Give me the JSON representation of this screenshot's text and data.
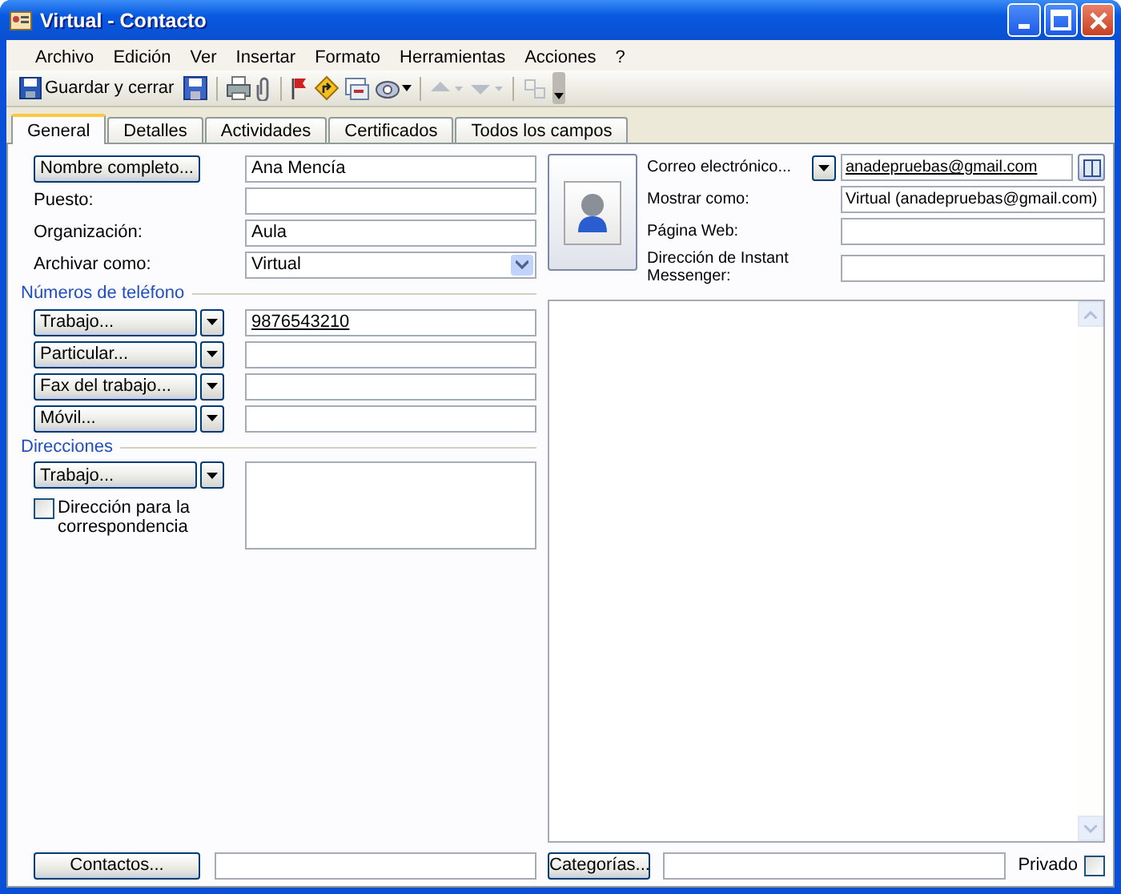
{
  "window": {
    "title": "Virtual - Contacto"
  },
  "menu": [
    "Archivo",
    "Edición",
    "Ver",
    "Insertar",
    "Formato",
    "Herramientas",
    "Acciones",
    "?"
  ],
  "toolbar": {
    "save_label": "Guardar y cerrar"
  },
  "tabs": [
    {
      "label": "General",
      "selected": true
    },
    {
      "label": "Detalles",
      "selected": false
    },
    {
      "label": "Actividades",
      "selected": false
    },
    {
      "label": "Certificados",
      "selected": false
    },
    {
      "label": "Todos los campos",
      "selected": false
    }
  ],
  "name": {
    "button": "Nombre completo...",
    "value": "Ana Mencía"
  },
  "fields": [
    {
      "label": "Puesto:"
    },
    {
      "label": "Organización:",
      "value": "Aula"
    }
  ],
  "file_as": {
    "label": "Archivar como:",
    "value": "Virtual"
  },
  "phones": {
    "title": "Números de teléfono",
    "items": [
      {
        "button": "Trabajo...",
        "value": "9876543210"
      },
      {
        "button": "Particular..."
      },
      {
        "button": "Fax del trabajo..."
      },
      {
        "button": "Móvil..."
      }
    ]
  },
  "addresses": {
    "title": "Direcciones",
    "button": "Trabajo...",
    "mailing_label": "Dirección para la correspondencia",
    "mailing_checked": false
  },
  "email": {
    "button": "Correo electrónico...",
    "value": "anadepruebas@gmail.com"
  },
  "right_fields": [
    {
      "label": "Mostrar como:",
      "value": "Virtual (anadepruebas@gmail.com)"
    },
    {
      "label": "Página Web:"
    },
    {
      "label": "Dirección de Instant Messenger:"
    }
  ],
  "footer": {
    "contacts_button": "Contactos...",
    "categories_button": "Categorías...",
    "private_label": "Privado",
    "private_checked": false
  }
}
